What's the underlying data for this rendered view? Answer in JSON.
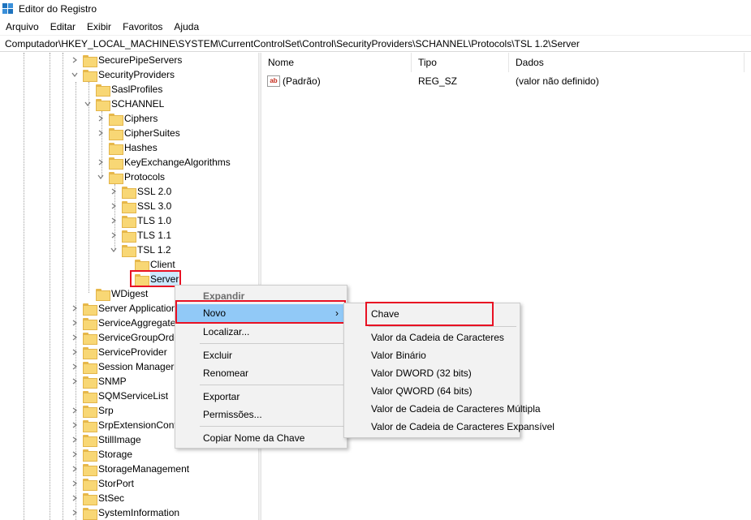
{
  "window": {
    "title": "Editor do Registro",
    "icon": "regedit-icon"
  },
  "menubar": [
    "Arquivo",
    "Editar",
    "Exibir",
    "Favoritos",
    "Ajuda"
  ],
  "address": "Computador\\HKEY_LOCAL_MACHINE\\SYSTEM\\CurrentControlSet\\Control\\SecurityProviders\\SCHANNEL\\Protocols\\TSL 1.2\\Server",
  "tree": {
    "top": [
      {
        "label": "SecurePipeServers",
        "chevron": "right"
      },
      {
        "label": "SecurityProviders",
        "chevron": "down"
      }
    ],
    "security_children": [
      {
        "label": "SaslProfiles",
        "chevron": "none"
      },
      {
        "label": "SCHANNEL",
        "chevron": "down"
      }
    ],
    "schannel_children": [
      {
        "label": "Ciphers",
        "chevron": "right"
      },
      {
        "label": "CipherSuites",
        "chevron": "right"
      },
      {
        "label": "Hashes",
        "chevron": "none"
      },
      {
        "label": "KeyExchangeAlgorithms",
        "chevron": "right"
      },
      {
        "label": "Protocols",
        "chevron": "down"
      }
    ],
    "protocols_children": [
      {
        "label": "SSL 2.0",
        "chevron": "right"
      },
      {
        "label": "SSL 3.0",
        "chevron": "right"
      },
      {
        "label": "TLS 1.0",
        "chevron": "right"
      },
      {
        "label": "TLS 1.1",
        "chevron": "right"
      },
      {
        "label": "TSL 1.2",
        "chevron": "down"
      }
    ],
    "tls12_children": [
      {
        "label": "Client"
      },
      {
        "label": "Server",
        "selected": true
      }
    ],
    "wdigest": "WDigest",
    "bottom": [
      "Server Application",
      "ServiceAggregate",
      "ServiceGroupOrde",
      "ServiceProvider",
      "Session Manager",
      "SNMP",
      "SQMServiceList",
      "Srp",
      "SrpExtensionConf",
      "StillImage",
      "Storage",
      "StorageManagement",
      "StorPort",
      "StSec",
      "SystemInformation"
    ]
  },
  "list": {
    "columns": [
      "Nome",
      "Tipo",
      "Dados"
    ],
    "rows": [
      {
        "name": "(Padrão)",
        "type": "REG_SZ",
        "data": "(valor não definido)",
        "icon": "string-value-icon"
      }
    ]
  },
  "context_menu": {
    "items": [
      "Expandir",
      "Novo",
      "Localizar...",
      "Excluir",
      "Renomear",
      "Exportar",
      "Permissões...",
      "Copiar Nome da Chave"
    ],
    "submenu_arrow": "›"
  },
  "submenu": {
    "items": [
      "Chave",
      "Valor da Cadeia de Caracteres",
      "Valor Binário",
      "Valor DWORD (32 bits)",
      "Valor QWORD (64 bits)",
      "Valor de Cadeia de Caracteres Múltipla",
      "Valor de Cadeia de Caracteres Expansível"
    ]
  },
  "colors": {
    "highlight_box": "#e81123",
    "menu_hover": "#91c9f7",
    "selection": "#cce8ff",
    "folder": "#f8d775"
  }
}
